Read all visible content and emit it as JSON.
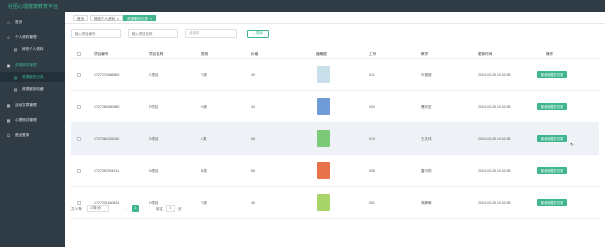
{
  "app": {
    "title": "社团心理健康教育平台"
  },
  "sidebar": {
    "items": [
      {
        "label": "首页",
        "icon": "home-icon",
        "glyph": "⌂",
        "sub": false,
        "active": false
      },
      {
        "label": "个人资料管理",
        "icon": "user-icon",
        "glyph": "☺",
        "sub": false,
        "active": false
      },
      {
        "label": "修改个人资料",
        "icon": "edit-icon",
        "glyph": "▤",
        "sub": true,
        "active": false
      },
      {
        "label": "资源服务管理",
        "icon": "folder-icon",
        "glyph": "▣",
        "sub": false,
        "active": false,
        "green": true
      },
      {
        "label": "资源服务记录",
        "icon": "list-icon",
        "glyph": "▤",
        "sub": true,
        "active": true
      },
      {
        "label": "资源服务收藏",
        "icon": "star-icon",
        "glyph": "▤",
        "sub": true,
        "active": false
      },
      {
        "label": "活动文章管理",
        "icon": "doc-icon",
        "glyph": "▦",
        "sub": false,
        "active": false
      },
      {
        "label": "心理测试管理",
        "icon": "test-icon",
        "glyph": "▦",
        "sub": false,
        "active": false
      },
      {
        "label": "退出登录",
        "icon": "logout-icon",
        "glyph": "⏻",
        "sub": false,
        "active": false
      }
    ]
  },
  "tabs": [
    {
      "label": "首页",
      "active": false
    },
    {
      "label": "修改个人资料",
      "active": false,
      "close": "×"
    },
    {
      "label": "资源服务记录",
      "active": true,
      "close": "×"
    }
  ],
  "search": {
    "field1_placeholder": "输入项目编号",
    "field2_placeholder": "输入项目名称",
    "field3_placeholder": "请选择",
    "button_label": "搜索",
    "button_icon": "search-icon"
  },
  "table": {
    "headers": [
      "项目编号",
      "项目名称",
      "类别",
      "价格",
      "缩略图",
      "工号",
      "教学",
      "更新时间",
      "操作"
    ],
    "rows": [
      {
        "code": "1727270466869",
        "name": "C项目",
        "category": "Y类",
        "price": "49",
        "staff_id": "011",
        "teacher": "叶振超",
        "time": "2024-03-25 10:42:36",
        "action": "取消收藏并记录",
        "thumb_color": "#c9e0ea",
        "highlight": false
      },
      {
        "code": "1727260560989",
        "name": "F项目",
        "category": "H类",
        "price": "34",
        "staff_id": "004",
        "teacher": "曹欣宏",
        "time": "2024-03-25 10:42:36",
        "action": "取消收藏并记录",
        "thumb_color": "#6f9bd6",
        "highlight": false
      },
      {
        "code": "1727060253040",
        "name": "D项目",
        "category": "L类",
        "price": "65",
        "staff_id": "014",
        "teacher": "王天伟",
        "time": "2024-03-25 10:42:36",
        "action": "取消收藏并记录",
        "thumb_color": "#7cc97a",
        "highlight": true
      },
      {
        "code": "1727087834911",
        "name": "N项目",
        "category": "B类",
        "price": "85",
        "staff_id": "008",
        "teacher": "雷中勤",
        "time": "2024-03-25 10:42:36",
        "action": "取消收藏并记录",
        "thumb_color": "#e8734a",
        "highlight": false
      },
      {
        "code": "1727201840824",
        "name": "H项目",
        "category": "Y类",
        "price": "45",
        "staff_id": "001",
        "teacher": "简静琳",
        "time": "2024-03-25 10:42:36",
        "action": "取消收藏并记录",
        "thumb_color": "#a8d46a",
        "highlight": false
      }
    ]
  },
  "pager": {
    "total_label": "共 5 条",
    "page_size": "10条/页",
    "current_page": "1",
    "goto_label": "前往",
    "goto_value": "1",
    "page_unit": "页"
  },
  "colors": {
    "accent": "#3fb68e",
    "sidebar_bg": "#2f3b45"
  }
}
